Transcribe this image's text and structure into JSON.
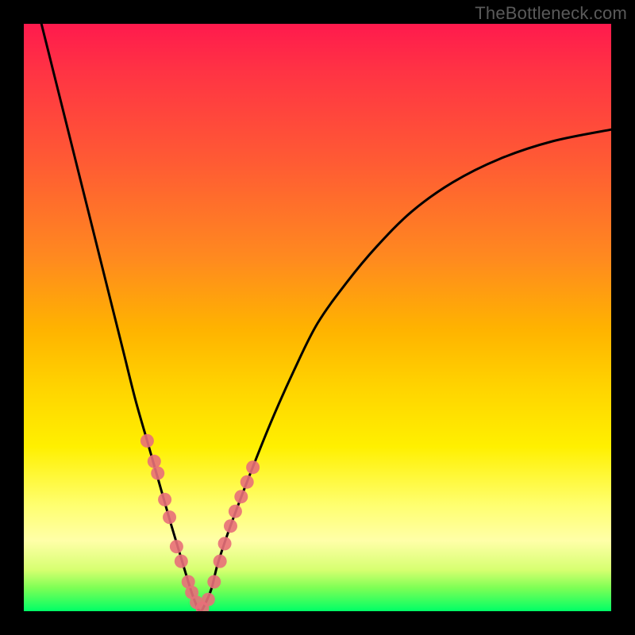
{
  "watermark": "TheBottleneck.com",
  "chart_data": {
    "type": "line",
    "title": "",
    "xlabel": "",
    "ylabel": "",
    "xlim": [
      0,
      100
    ],
    "ylim": [
      0,
      100
    ],
    "series": [
      {
        "name": "bottleneck-curve",
        "x": [
          3,
          5,
          7,
          9,
          11,
          13,
          15,
          17,
          19,
          21,
          23,
          25,
          26.5,
          28,
          29,
          30,
          31,
          32,
          33,
          35,
          38,
          42,
          46,
          50,
          55,
          60,
          66,
          73,
          81,
          90,
          100
        ],
        "y": [
          100,
          92,
          84,
          76,
          68,
          60,
          52,
          44,
          36,
          29,
          22,
          15,
          10,
          5,
          2,
          0,
          1.5,
          4,
          8,
          14,
          22,
          32,
          41,
          49,
          56,
          62,
          68,
          73,
          77,
          80,
          82
        ]
      },
      {
        "name": "highlight-dots",
        "x": [
          21,
          22.2,
          22.8,
          24,
          24.8,
          26,
          26.8,
          28,
          28.6,
          29.4,
          30.4,
          31.4,
          32.4,
          33.4,
          34.2,
          35.2,
          36,
          37,
          38,
          39
        ],
        "y": [
          29,
          25.5,
          23.5,
          19,
          16,
          11,
          8.5,
          5,
          3.2,
          1.5,
          0.5,
          2,
          5,
          8.5,
          11.5,
          14.5,
          17,
          19.5,
          22,
          24.5
        ]
      }
    ],
    "colors": {
      "curve": "#000000",
      "dots": "#e86f79",
      "gradient_top": "#ff1a4d",
      "gradient_bottom": "#00ff66"
    }
  }
}
